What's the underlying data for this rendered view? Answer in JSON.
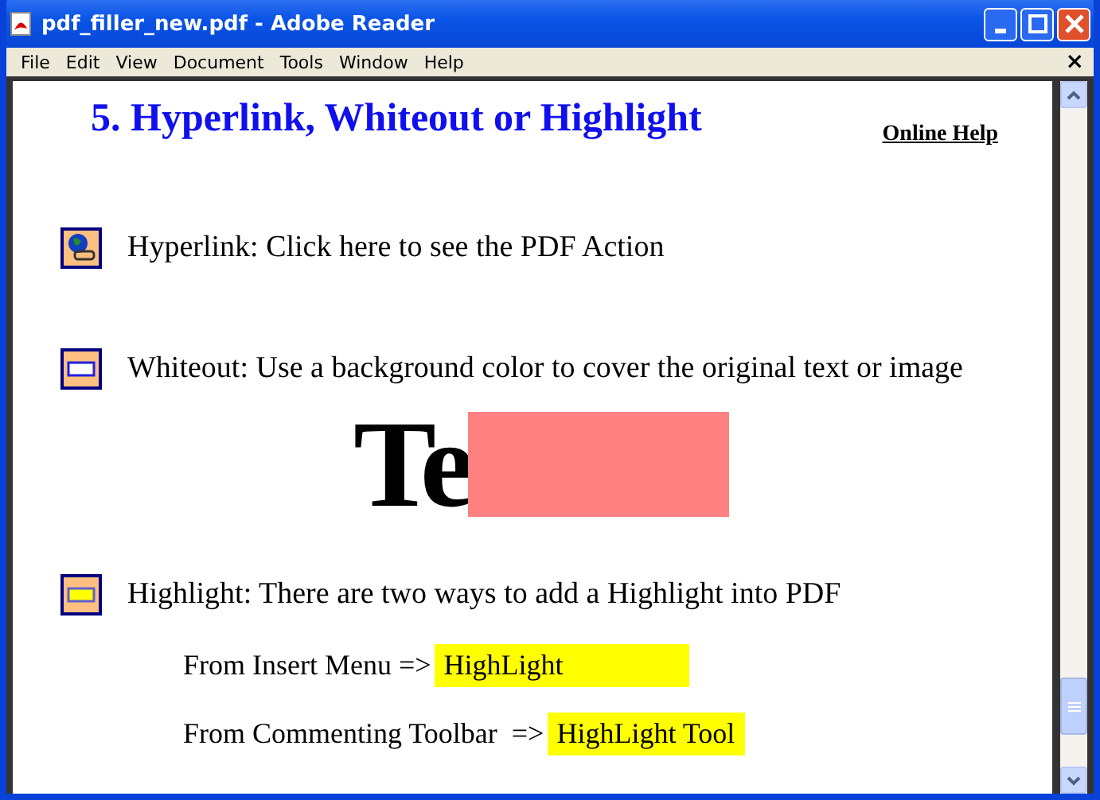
{
  "window": {
    "title": "pdf_filler_new.pdf - Adobe Reader"
  },
  "menu": [
    "File",
    "Edit",
    "View",
    "Document",
    "Tools",
    "Window",
    "Help"
  ],
  "menu_close": "×",
  "page": {
    "heading": "5. Hyperlink, Whiteout or Highlight",
    "help_link": "Online Help",
    "items": [
      {
        "kind": "hyperlink",
        "text": "Hyperlink:  Click here to see the PDF Action"
      },
      {
        "kind": "whiteout",
        "text": "Whiteout: Use a background color to cover the original text or image",
        "sample": "Te"
      },
      {
        "kind": "highlight",
        "text": "Highlight: There are two ways to add a Highlight into PDF",
        "ways": [
          {
            "label": "From Insert Menu =>",
            "value": "HighLight"
          },
          {
            "label": "From Commenting Toolbar  =>",
            "value": "HighLight Tool"
          }
        ]
      }
    ]
  }
}
